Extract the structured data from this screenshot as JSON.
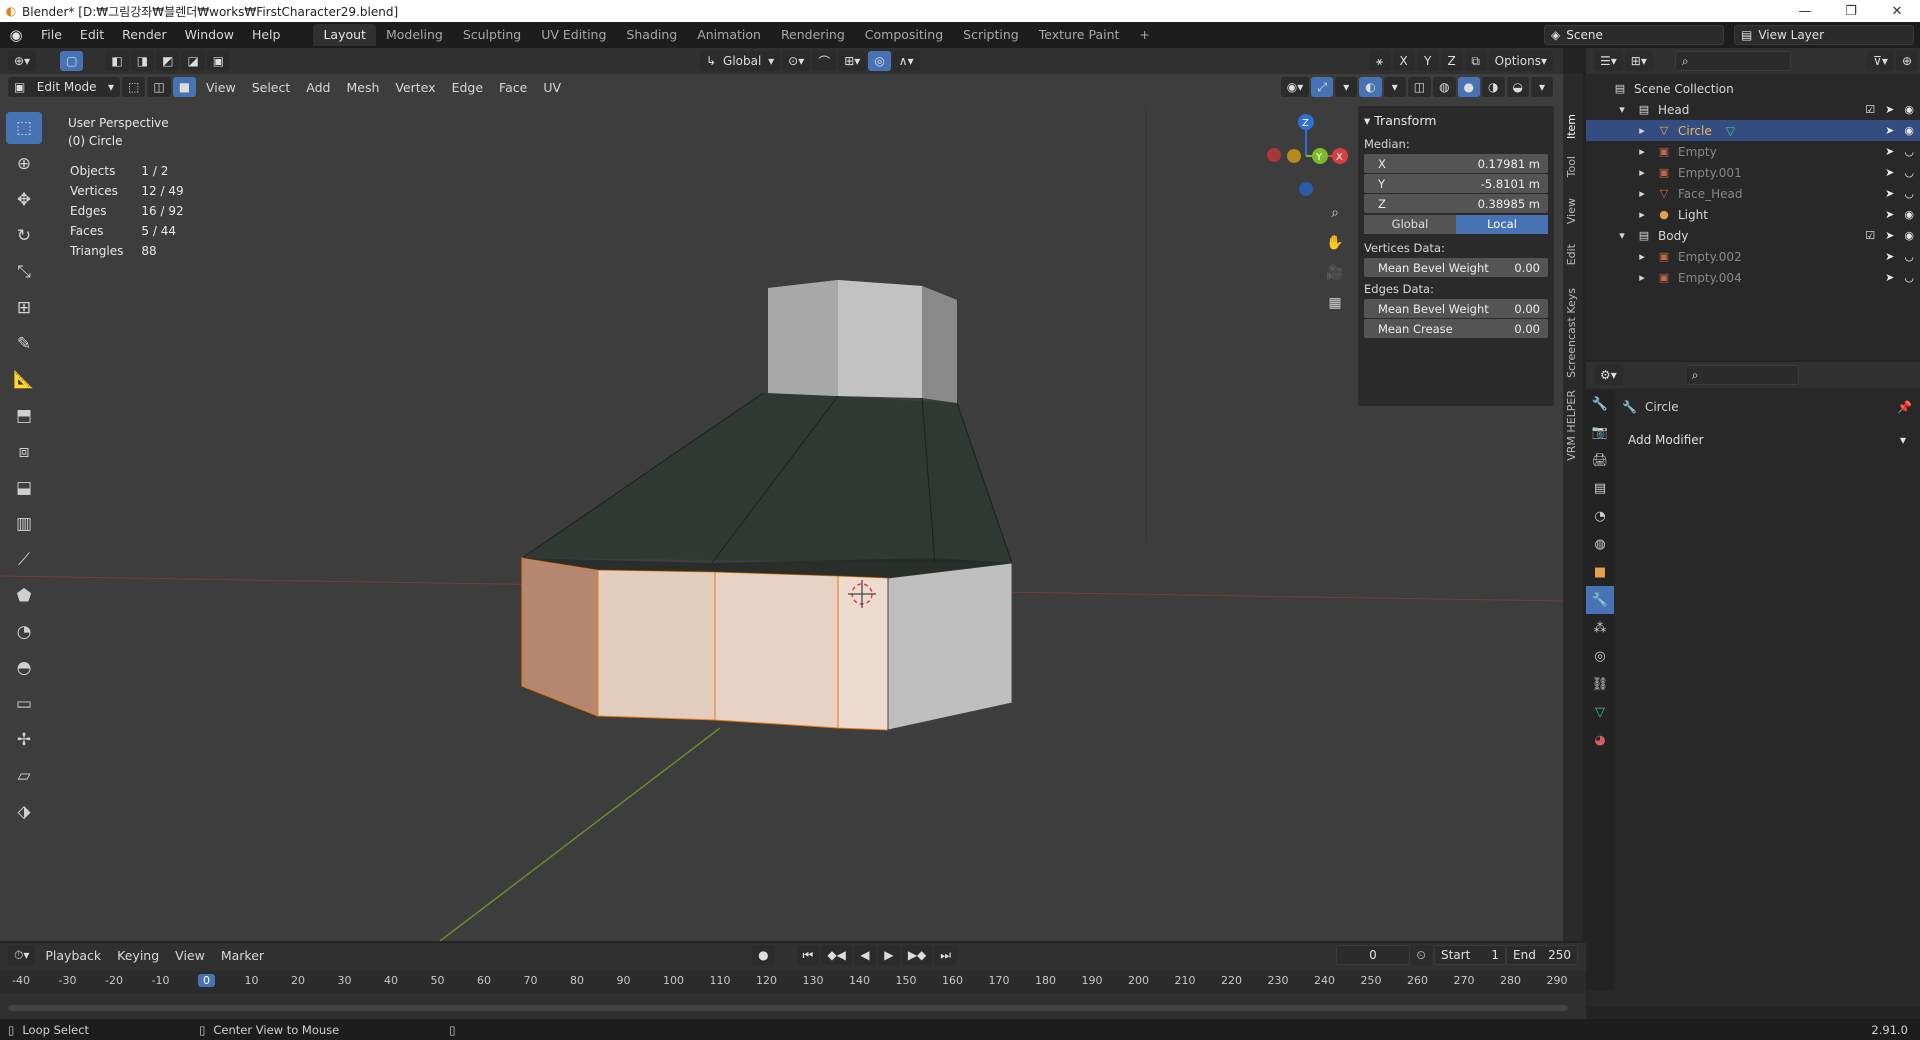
{
  "window": {
    "title": "Blender* [D:₩그림강좌₩블렌더₩works₩FirstCharacter29.blend]",
    "minimize": "—",
    "maximize": "❐",
    "close": "✕"
  },
  "topbar": {
    "menus": [
      "File",
      "Edit",
      "Render",
      "Window",
      "Help"
    ],
    "workspaces": [
      "Layout",
      "Modeling",
      "Sculpting",
      "UV Editing",
      "Shading",
      "Animation",
      "Rendering",
      "Compositing",
      "Scripting",
      "Texture Paint"
    ],
    "active_workspace": "Layout",
    "add_workspace": "+",
    "scene": "Scene",
    "view_layer": "View Layer"
  },
  "viewport": {
    "mode": "Edit Mode",
    "menus": [
      "View",
      "Select",
      "Add",
      "Mesh",
      "Vertex",
      "Edge",
      "Face",
      "UV"
    ],
    "orientation": "Global",
    "options": "Options",
    "axes": [
      "X",
      "Y",
      "Z"
    ],
    "perspective": "User Perspective",
    "object_label": "(0) Circle",
    "stats": [
      {
        "label": "Objects",
        "value": "1 / 2"
      },
      {
        "label": "Vertices",
        "value": "12 / 49"
      },
      {
        "label": "Edges",
        "value": "16 / 92"
      },
      {
        "label": "Faces",
        "value": "5 / 44"
      },
      {
        "label": "Triangles",
        "value": "88"
      }
    ],
    "gizmo": {
      "x": "X",
      "y": "Y",
      "z": "Z"
    }
  },
  "npanel": {
    "title": "Transform",
    "median_label": "Median:",
    "x_label": "X",
    "x_value": "0.17981 m",
    "y_label": "Y",
    "y_value": "-5.8101 m",
    "z_label": "Z",
    "z_value": "0.38985 m",
    "global": "Global",
    "local": "Local",
    "vertices_data": "Vertices Data:",
    "mean_bevel_weight": "Mean Bevel Weight",
    "mean_bevel_weight_v": "0.00",
    "edges_data": "Edges Data:",
    "mean_bevel_weight_e": "Mean Bevel Weight",
    "mean_bevel_weight_e_v": "0.00",
    "mean_crease": "Mean Crease",
    "mean_crease_v": "0.00",
    "side_tabs": [
      "Item",
      "Tool",
      "View",
      "Edit",
      "Screencast Keys",
      "VRM HELPER"
    ]
  },
  "outliner": {
    "root": "Scene Collection",
    "items": [
      {
        "name": "Head",
        "type": "collection",
        "depth": 0
      },
      {
        "name": "Circle",
        "type": "mesh",
        "depth": 1,
        "selected": true
      },
      {
        "name": "Empty",
        "type": "empty",
        "depth": 1
      },
      {
        "name": "Empty.001",
        "type": "empty",
        "depth": 1
      },
      {
        "name": "Face_Head",
        "type": "mesh",
        "depth": 1
      },
      {
        "name": "Light",
        "type": "light",
        "depth": 1
      },
      {
        "name": "Body",
        "type": "collection",
        "depth": 0
      },
      {
        "name": "Empty.002",
        "type": "empty",
        "depth": 1
      },
      {
        "name": "Empty.004",
        "type": "empty",
        "depth": 1
      }
    ]
  },
  "properties": {
    "object_name": "Circle",
    "add_modifier": "Add Modifier"
  },
  "timeline": {
    "menus": [
      "Playback",
      "Keying",
      "View",
      "Marker"
    ],
    "current_frame": "0",
    "start_label": "Start",
    "start": "1",
    "end_label": "End",
    "end": "250",
    "ticks": [
      "-40",
      "-30",
      "-20",
      "-10",
      "0",
      "10",
      "20",
      "30",
      "40",
      "50",
      "60",
      "70",
      "80",
      "90",
      "100",
      "110",
      "120",
      "130",
      "140",
      "150",
      "160",
      "170",
      "180",
      "190",
      "200",
      "210",
      "220",
      "230",
      "240",
      "250",
      "260",
      "270",
      "280",
      "290"
    ]
  },
  "statusbar": {
    "left": "Loop Select",
    "middle": "Center View to Mouse",
    "version": "2.91.0"
  },
  "colors": {
    "accent": "#4772b3",
    "selected_face": "#e8d2c6",
    "orange": "#e87d0d"
  }
}
